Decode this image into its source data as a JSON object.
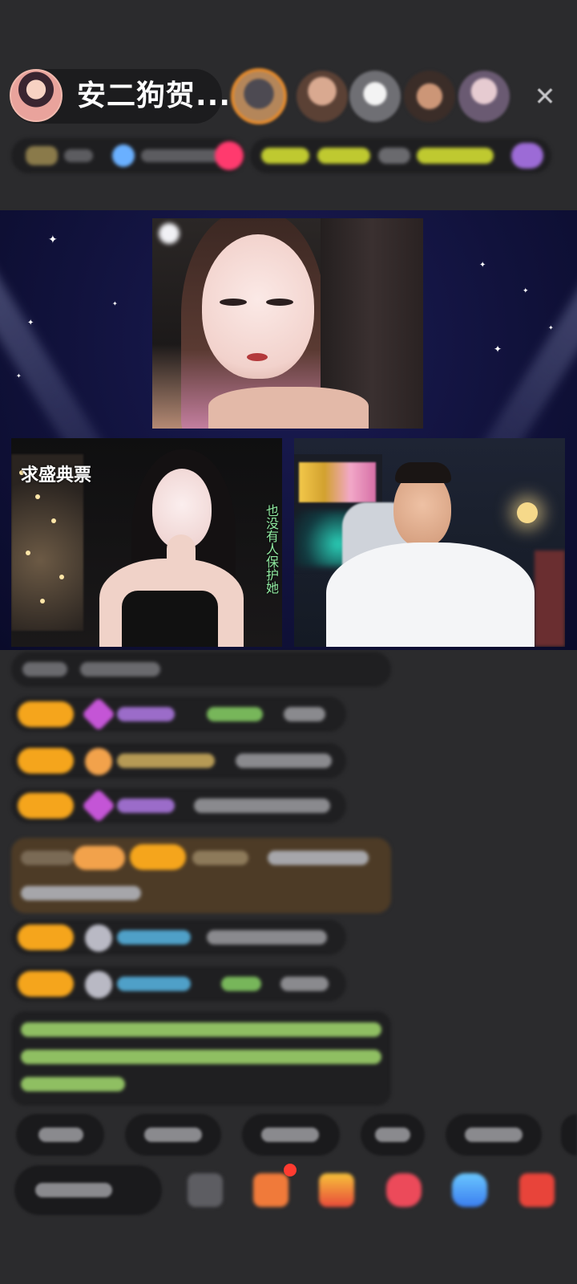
{
  "host": {
    "name": "安二狗贺..."
  },
  "viewers_strip": {
    "close_icon": "✕"
  },
  "stage": {
    "left_caption": "求盛典票",
    "left_overlay_vertical": "也没有人保护她"
  },
  "colors": {
    "background": "#2b2b2d",
    "stage_bg": "#11123c",
    "badge_yellow": "#f5a51c",
    "gift_row_bg": "#4d3b26"
  }
}
